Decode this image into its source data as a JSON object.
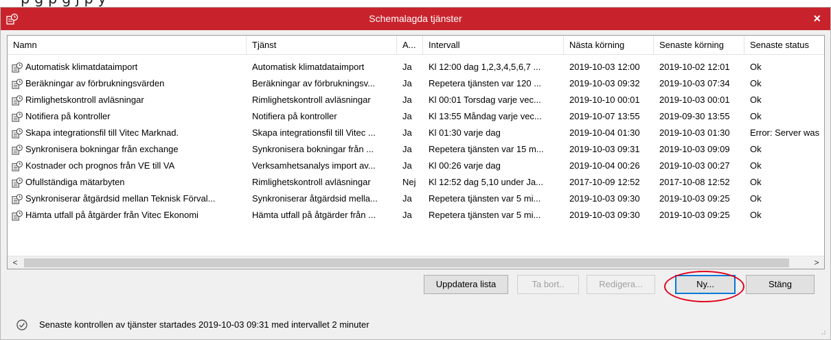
{
  "window": {
    "title": "Schemalagda tjänster",
    "close_glyph": "×",
    "accent_color": "#c8232c"
  },
  "columns": [
    "Namn",
    "Tjänst",
    "A...",
    "Intervall",
    "Nästa körning",
    "Senaste körning",
    "Senaste status"
  ],
  "rows": [
    {
      "namn": "Automatisk klimatdataimport",
      "tjanst": "Automatisk klimatdataimport",
      "aktiv": "Ja",
      "intervall": "Kl 12:00 dag 1,2,3,4,5,6,7 ...",
      "nasta": "2019-10-03 12:00",
      "senaste": "2019-10-02 12:01",
      "status": "Ok"
    },
    {
      "namn": "Beräkningar av förbrukningsvärden",
      "tjanst": "Beräkningar av förbrukningsv...",
      "aktiv": "Ja",
      "intervall": "Repetera tjänsten var 120 ...",
      "nasta": "2019-10-03 09:32",
      "senaste": "2019-10-03 07:34",
      "status": "Ok"
    },
    {
      "namn": "Rimlighetskontroll avläsningar",
      "tjanst": "Rimlighetskontroll avläsningar",
      "aktiv": "Ja",
      "intervall": "Kl 00:01 Torsdag varje vec...",
      "nasta": "2019-10-10 00:01",
      "senaste": "2019-10-03 00:01",
      "status": "Ok"
    },
    {
      "namn": "Notifiera på kontroller",
      "tjanst": "Notifiera på kontroller",
      "aktiv": "Ja",
      "intervall": "Kl 13:55 Måndag varje vec...",
      "nasta": "2019-10-07 13:55",
      "senaste": "2019-09-30 13:55",
      "status": "Ok"
    },
    {
      "namn": "Skapa integrationsfil till Vitec Marknad.",
      "tjanst": "Skapa integrationsfil till Vitec ...",
      "aktiv": "Ja",
      "intervall": "Kl 01:30 varje dag",
      "nasta": "2019-10-04 01:30",
      "senaste": "2019-10-03 01:30",
      "status": "Error: Server was"
    },
    {
      "namn": "Synkronisera bokningar från exchange",
      "tjanst": "Synkronisera bokningar från ...",
      "aktiv": "Ja",
      "intervall": "Repetera tjänsten var 15 m...",
      "nasta": "2019-10-03 09:31",
      "senaste": "2019-10-03 09:09",
      "status": "Ok"
    },
    {
      "namn": "Kostnader och prognos från VE till VA",
      "tjanst": "Verksamhetsanalys import av...",
      "aktiv": "Ja",
      "intervall": "Kl 00:26 varje dag",
      "nasta": "2019-10-04 00:26",
      "senaste": "2019-10-03 00:27",
      "status": "Ok"
    },
    {
      "namn": "Ofullständiga mätarbyten",
      "tjanst": "Rimlighetskontroll avläsningar",
      "aktiv": "Nej",
      "intervall": "Kl 12:52 dag 5,10 under Ja...",
      "nasta": "2017-10-09 12:52",
      "senaste": "2017-10-08 12:52",
      "status": "Ok"
    },
    {
      "namn": "Synkroniserar åtgärdsid mellan Teknisk Förval...",
      "tjanst": "Synkroniserar åtgärdsid mella...",
      "aktiv": "Ja",
      "intervall": "Repetera tjänsten var 5 mi...",
      "nasta": "2019-10-03 09:30",
      "senaste": "2019-10-03 09:25",
      "status": "Ok"
    },
    {
      "namn": "Hämta utfall på åtgärder från Vitec Ekonomi",
      "tjanst": "Hämta utfall på åtgärder från ...",
      "aktiv": "Ja",
      "intervall": "Repetera tjänsten var 5 mi...",
      "nasta": "2019-10-03 09:30",
      "senaste": "2019-10-03 09:25",
      "status": "Ok"
    }
  ],
  "buttons": {
    "uppdatera": "Uppdatera lista",
    "ta_bort": "Ta bort..",
    "redigera": "Redigera...",
    "ny": "Ny...",
    "stang": "Stäng"
  },
  "scroll_arrows": {
    "left": "<",
    "right": ">"
  },
  "status_text": "Senaste kontrollen av tjänster startades 2019-10-03 09:31 med intervallet 2 minuter",
  "colors": {
    "titlebar": "#c8232c",
    "highlight_oval": "#e0001a",
    "default_button_border": "#0078d7"
  }
}
